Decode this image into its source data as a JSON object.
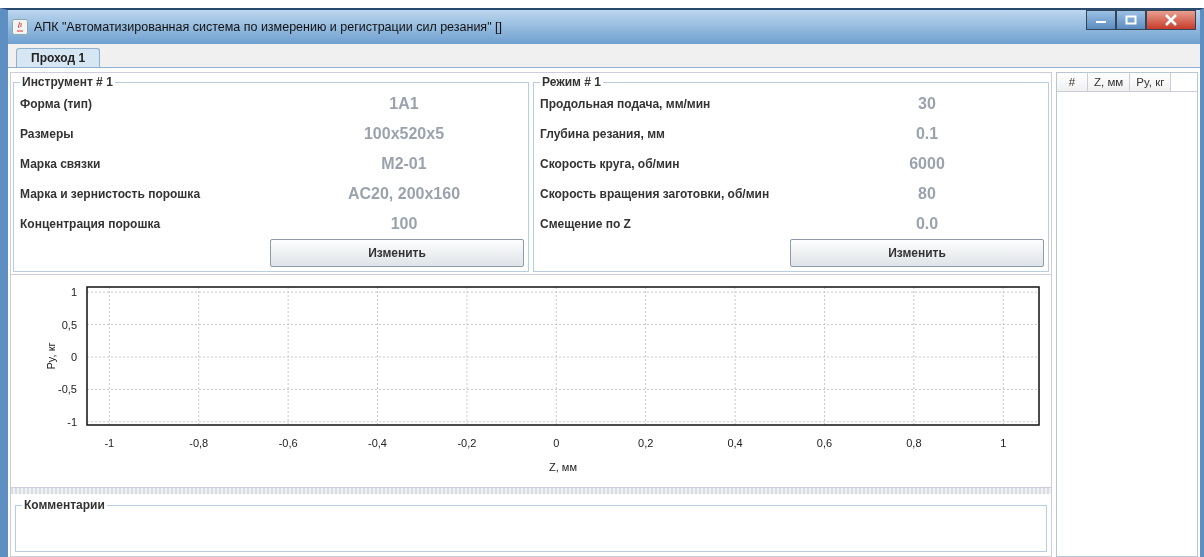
{
  "window": {
    "title": "АПК \"Автоматизированная система по измерению и регистрации сил резания\" []"
  },
  "tabs": [
    {
      "label": "Проход 1",
      "selected": true
    }
  ],
  "tool_panel": {
    "title": "Инструмент # 1",
    "rows": [
      {
        "label": "Форма (тип)",
        "value": "1A1"
      },
      {
        "label": "Размеры",
        "value": "100x520x5"
      },
      {
        "label": "Марка связки",
        "value": "M2-01"
      },
      {
        "label": "Марка и зернистость порошка",
        "value": "AC20, 200x160"
      },
      {
        "label": "Концентрация порошка",
        "value": "100"
      }
    ],
    "button": "Изменить"
  },
  "mode_panel": {
    "title": "Режим # 1",
    "rows": [
      {
        "label": "Продольная подача, мм/мин",
        "value": "30"
      },
      {
        "label": "Глубина резания, мм",
        "value": "0.1"
      },
      {
        "label": "Скорость круга, об/мин",
        "value": "6000"
      },
      {
        "label": "Скорость вращения заготовки, об/мин",
        "value": "80"
      },
      {
        "label": "Смещение по Z",
        "value": "0.0"
      }
    ],
    "button": "Изменить"
  },
  "chart": {
    "chart_data": {
      "type": "line",
      "grid": true,
      "xlabel": "Z, мм",
      "ylabel": "Py, кг",
      "xlim": [
        -1.05,
        1.08
      ],
      "ylim": [
        -1.05,
        1.08
      ],
      "xticks": [
        {
          "value": -1,
          "label": "-1"
        },
        {
          "value": -0.8,
          "label": "-0,8"
        },
        {
          "value": -0.6,
          "label": "-0,6"
        },
        {
          "value": -0.4,
          "label": "-0,4"
        },
        {
          "value": -0.2,
          "label": "-0,2"
        },
        {
          "value": 0,
          "label": "0"
        },
        {
          "value": 0.2,
          "label": "0,2"
        },
        {
          "value": 0.4,
          "label": "0,4"
        },
        {
          "value": 0.6,
          "label": "0,6"
        },
        {
          "value": 0.8,
          "label": "0,8"
        },
        {
          "value": 1,
          "label": "1"
        }
      ],
      "yticks": [
        {
          "value": -1,
          "label": "-1"
        },
        {
          "value": -0.5,
          "label": "-0,5"
        },
        {
          "value": 0,
          "label": "0"
        },
        {
          "value": 0.5,
          "label": "0,5"
        },
        {
          "value": 1,
          "label": "1"
        }
      ]
    }
  },
  "comments": {
    "title": "Комментарии"
  },
  "table": {
    "columns": [
      "#",
      "Z, мм",
      "Py, кг"
    ]
  }
}
